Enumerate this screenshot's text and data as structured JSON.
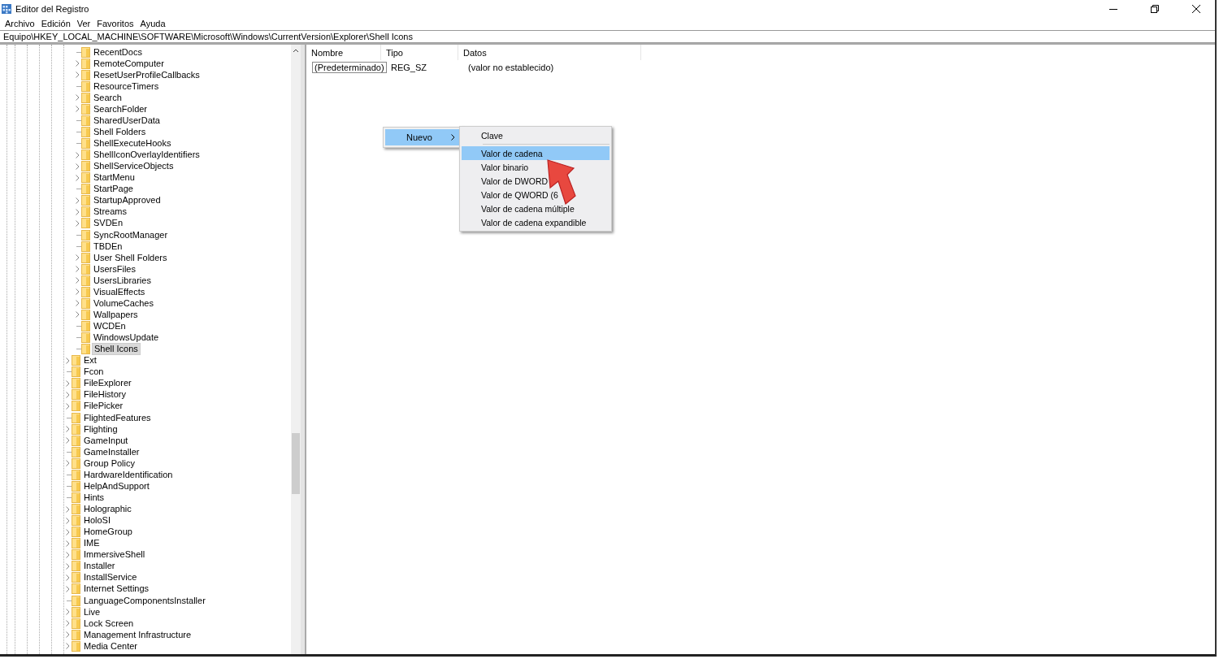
{
  "window": {
    "title": "Editor del Registro"
  },
  "menu_bar": [
    "Archivo",
    "Edición",
    "Ver",
    "Favoritos",
    "Ayuda"
  ],
  "address_bar": {
    "value": "Equipo\\HKEY_LOCAL_MACHINE\\SOFTWARE\\Microsoft\\Windows\\CurrentVersion\\Explorer\\Shell Icons"
  },
  "tree": {
    "inner_items": [
      {
        "label": "RecentDocs",
        "expandable": false,
        "selected": false
      },
      {
        "label": "RemoteComputer",
        "expandable": true,
        "selected": false
      },
      {
        "label": "ResetUserProfileCallbacks",
        "expandable": true,
        "selected": false
      },
      {
        "label": "ResourceTimers",
        "expandable": false,
        "selected": false
      },
      {
        "label": "Search",
        "expandable": true,
        "selected": false
      },
      {
        "label": "SearchFolder",
        "expandable": true,
        "selected": false
      },
      {
        "label": "SharedUserData",
        "expandable": false,
        "selected": false
      },
      {
        "label": "Shell Folders",
        "expandable": false,
        "selected": false
      },
      {
        "label": "ShellExecuteHooks",
        "expandable": false,
        "selected": false
      },
      {
        "label": "ShellIconOverlayIdentifiers",
        "expandable": true,
        "selected": false
      },
      {
        "label": "ShellServiceObjects",
        "expandable": true,
        "selected": false
      },
      {
        "label": "StartMenu",
        "expandable": true,
        "selected": false
      },
      {
        "label": "StartPage",
        "expandable": false,
        "selected": false
      },
      {
        "label": "StartupApproved",
        "expandable": true,
        "selected": false
      },
      {
        "label": "Streams",
        "expandable": true,
        "selected": false
      },
      {
        "label": "SVDEn",
        "expandable": true,
        "selected": false
      },
      {
        "label": "SyncRootManager",
        "expandable": false,
        "selected": false
      },
      {
        "label": "TBDEn",
        "expandable": false,
        "selected": false
      },
      {
        "label": "User Shell Folders",
        "expandable": true,
        "selected": false
      },
      {
        "label": "UsersFiles",
        "expandable": true,
        "selected": false
      },
      {
        "label": "UsersLibraries",
        "expandable": true,
        "selected": false
      },
      {
        "label": "VisualEffects",
        "expandable": true,
        "selected": false
      },
      {
        "label": "VolumeCaches",
        "expandable": true,
        "selected": false
      },
      {
        "label": "Wallpapers",
        "expandable": true,
        "selected": false
      },
      {
        "label": "WCDEn",
        "expandable": false,
        "selected": false
      },
      {
        "label": "WindowsUpdate",
        "expandable": false,
        "selected": false
      },
      {
        "label": "Shell Icons",
        "expandable": false,
        "selected": true
      }
    ],
    "outer_items": [
      {
        "label": "Ext",
        "expandable": true,
        "selected": false
      },
      {
        "label": "Fcon",
        "expandable": false,
        "selected": false
      },
      {
        "label": "FileExplorer",
        "expandable": true,
        "selected": false
      },
      {
        "label": "FileHistory",
        "expandable": true,
        "selected": false
      },
      {
        "label": "FilePicker",
        "expandable": true,
        "selected": false
      },
      {
        "label": "FlightedFeatures",
        "expandable": false,
        "selected": false
      },
      {
        "label": "Flighting",
        "expandable": true,
        "selected": false
      },
      {
        "label": "GameInput",
        "expandable": true,
        "selected": false
      },
      {
        "label": "GameInstaller",
        "expandable": false,
        "selected": false
      },
      {
        "label": "Group Policy",
        "expandable": true,
        "selected": false
      },
      {
        "label": "HardwareIdentification",
        "expandable": false,
        "selected": false
      },
      {
        "label": "HelpAndSupport",
        "expandable": false,
        "selected": false
      },
      {
        "label": "Hints",
        "expandable": false,
        "selected": false
      },
      {
        "label": "Holographic",
        "expandable": true,
        "selected": false
      },
      {
        "label": "HoloSI",
        "expandable": true,
        "selected": false
      },
      {
        "label": "HomeGroup",
        "expandable": true,
        "selected": false
      },
      {
        "label": "IME",
        "expandable": true,
        "selected": false
      },
      {
        "label": "ImmersiveShell",
        "expandable": true,
        "selected": false
      },
      {
        "label": "Installer",
        "expandable": true,
        "selected": false
      },
      {
        "label": "InstallService",
        "expandable": true,
        "selected": false
      },
      {
        "label": "Internet Settings",
        "expandable": true,
        "selected": false
      },
      {
        "label": "LanguageComponentsInstaller",
        "expandable": false,
        "selected": false
      },
      {
        "label": "Live",
        "expandable": true,
        "selected": false
      },
      {
        "label": "Lock Screen",
        "expandable": true,
        "selected": false
      },
      {
        "label": "Management Infrastructure",
        "expandable": true,
        "selected": false
      },
      {
        "label": "Media Center",
        "expandable": true,
        "selected": false
      }
    ]
  },
  "values_table": {
    "columns": [
      "Nombre",
      "Tipo",
      "Datos"
    ],
    "rows": [
      {
        "name": "(Predeterminado)",
        "type": "REG_SZ",
        "data": "(valor no establecido)"
      }
    ]
  },
  "context_menu": {
    "items": [
      {
        "label": "Nuevo",
        "selected": true
      }
    ],
    "submenu": [
      {
        "label": "Clave",
        "selected": false
      },
      {
        "label": "Valor de cadena",
        "selected": true
      },
      {
        "label": "Valor binario",
        "selected": false
      },
      {
        "label": "Valor de DWORD",
        "selected": false
      },
      {
        "label": "Valor de QWORD (6",
        "selected": false
      },
      {
        "label": "Valor de cadena múltiple",
        "selected": false
      },
      {
        "label": "Valor de cadena expandible",
        "selected": false
      }
    ]
  }
}
